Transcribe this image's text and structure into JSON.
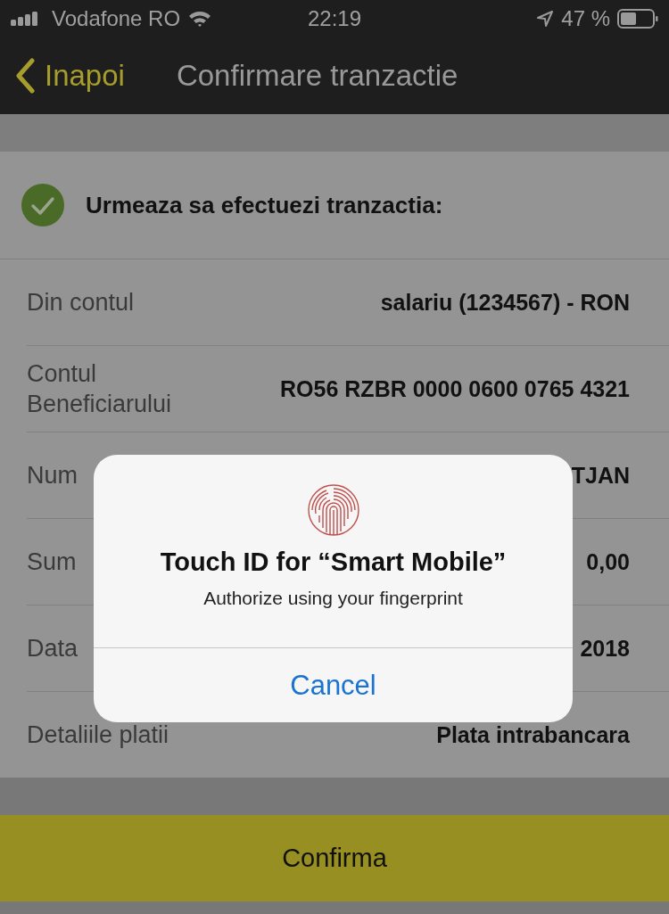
{
  "status_bar": {
    "carrier": "Vodafone RO",
    "time": "22:19",
    "battery": "47 %"
  },
  "nav": {
    "back": "Inapoi",
    "title": "Confirmare tranzactie"
  },
  "header": {
    "text": "Urmeaza sa efectuezi tranzactia:"
  },
  "rows": [
    {
      "label": "Din contul",
      "value": "salariu (1234567) - RON"
    },
    {
      "label": "Contul Beneficiarului",
      "value": "RO56 RZBR 0000 0600 0765 4321"
    },
    {
      "label": "Num",
      "value": "TJAN"
    },
    {
      "label": "Sum",
      "value": "0,00"
    },
    {
      "label": "Data",
      "value": "2018"
    },
    {
      "label": "Detaliile platii",
      "value": "Plata intrabancara"
    }
  ],
  "confirm_button": "Confirma",
  "dialog": {
    "title": "Touch ID for “Smart Mobile”",
    "message": "Authorize using your fingerprint",
    "cancel": "Cancel"
  }
}
